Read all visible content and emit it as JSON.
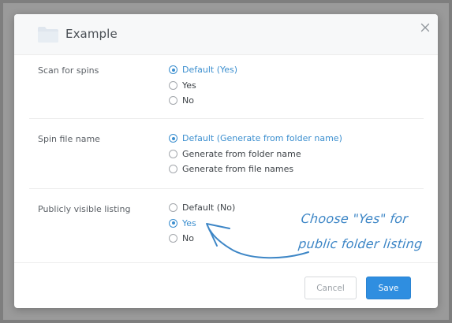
{
  "dialog": {
    "title": "Example",
    "close_icon": "close-icon",
    "folder_icon": "folder-icon"
  },
  "settings": [
    {
      "label": "Scan for spins",
      "options": [
        "Default (Yes)",
        "Yes",
        "No"
      ],
      "selected": 0
    },
    {
      "label": "Spin file name",
      "options": [
        "Default (Generate from folder name)",
        "Generate from folder name",
        "Generate from file names"
      ],
      "selected": 0
    },
    {
      "label": "Publicly visible listing",
      "options": [
        "Default (No)",
        "Yes",
        "No"
      ],
      "selected": 1
    }
  ],
  "footer": {
    "cancel_label": "Cancel",
    "save_label": "Save"
  },
  "annotation": {
    "line1": "Choose \"Yes\" for",
    "line2": "public folder listing"
  },
  "colors": {
    "accent": "#3c8fcf",
    "save_button": "#2f8ee0",
    "annotation": "#3d86c6"
  }
}
